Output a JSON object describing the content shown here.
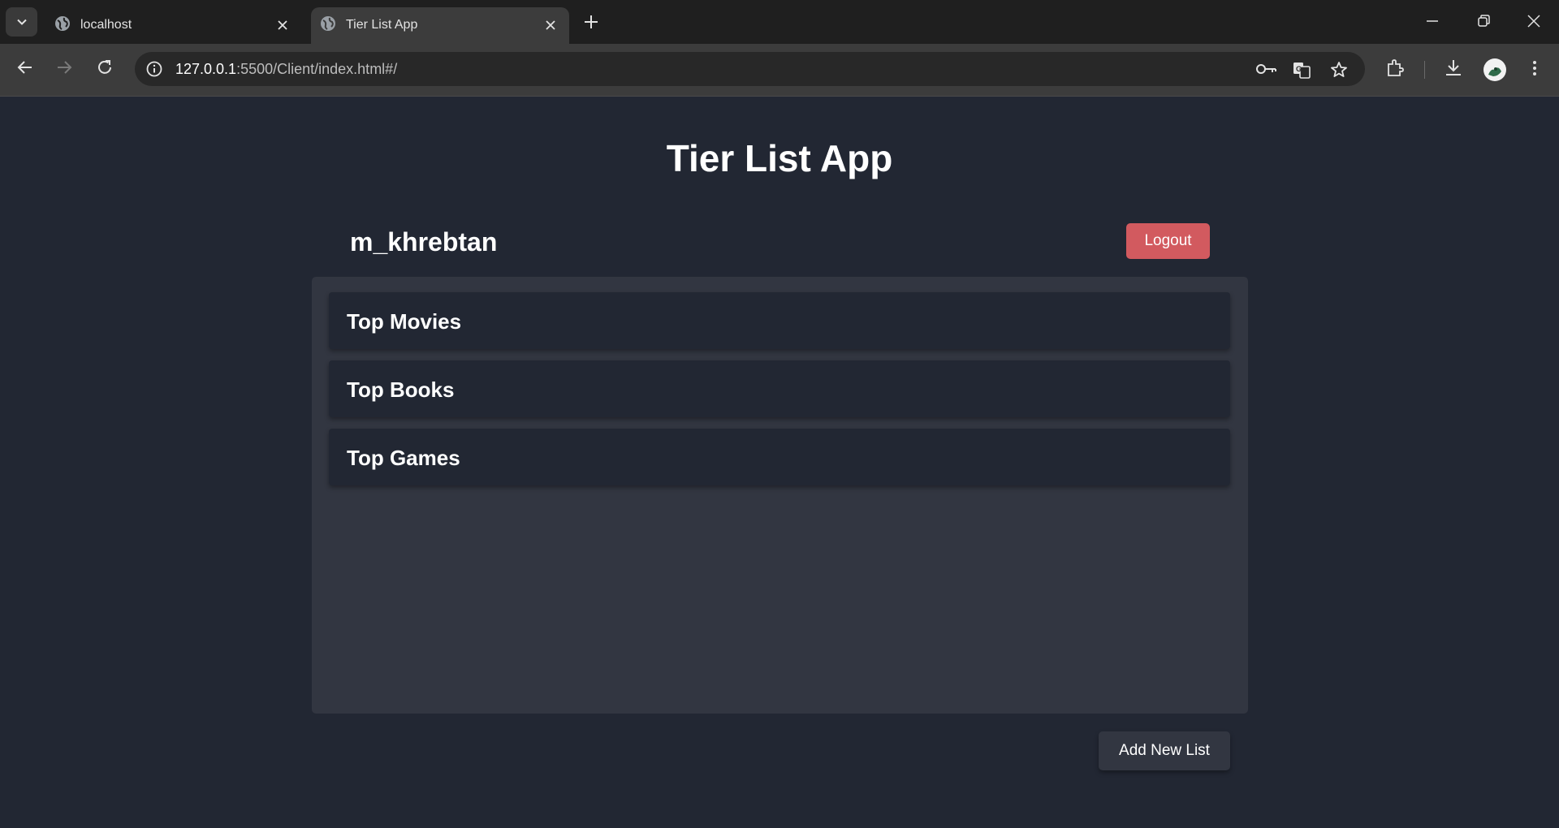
{
  "browser": {
    "tabs": [
      {
        "title": "localhost",
        "active": false
      },
      {
        "title": "Tier List App",
        "active": true
      }
    ],
    "url": {
      "host": "127.0.0.1",
      "rest": ":5500/Client/index.html#/"
    }
  },
  "app": {
    "title": "Tier List App",
    "username": "m_khrebtan",
    "logout_label": "Logout",
    "lists": [
      {
        "name": "Top Movies"
      },
      {
        "name": "Top Books"
      },
      {
        "name": "Top Games"
      }
    ],
    "add_list_label": "Add New List"
  },
  "colors": {
    "background": "#222733",
    "panel": "#323641",
    "logout": "#d25a5f"
  }
}
